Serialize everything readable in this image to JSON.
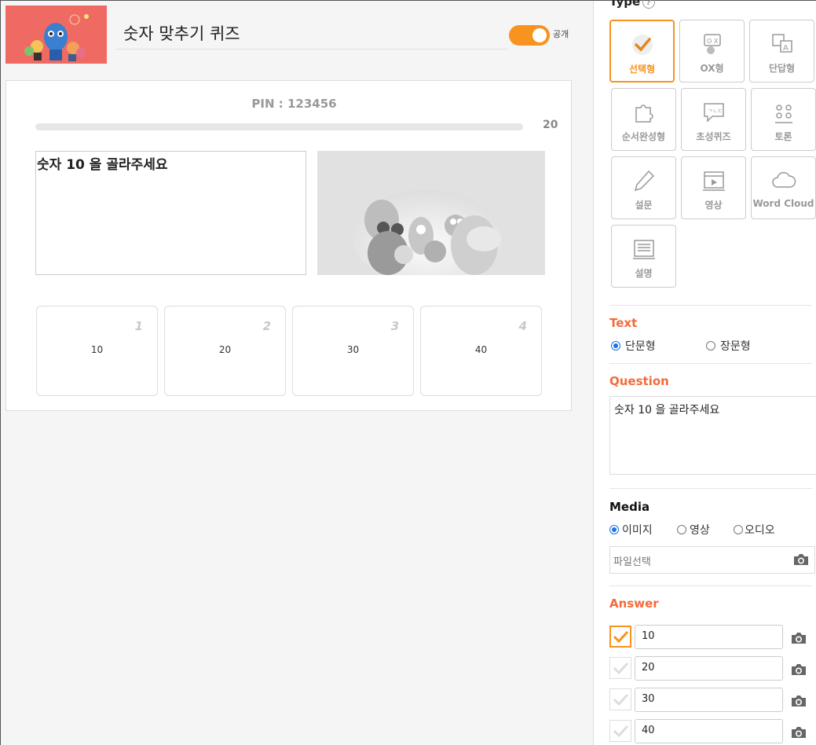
{
  "header": {
    "quiz_title": "숫자 맞추기 퀴즈",
    "toggle_label": "공개",
    "toggle_on": true
  },
  "preview": {
    "pin": "PIN : 123456",
    "timer": "20",
    "question": "숫자 10 을 골라주세요",
    "answers": [
      {
        "num": "1",
        "text": "10"
      },
      {
        "num": "2",
        "text": "20"
      },
      {
        "num": "3",
        "text": "30"
      },
      {
        "num": "4",
        "text": "40"
      }
    ]
  },
  "panel": {
    "type_title": "Type",
    "help_glyph": "?",
    "types": [
      {
        "label": "선택형",
        "icon": "check-icon",
        "active": true
      },
      {
        "label": "OX형",
        "icon": "ox-icon",
        "active": false
      },
      {
        "label": "단답형",
        "icon": "short-answer-icon",
        "active": false
      },
      {
        "label": "순서완성형",
        "icon": "puzzle-icon",
        "active": false
      },
      {
        "label": "초성퀴즈",
        "icon": "speech-bubble-icon",
        "active": false
      },
      {
        "label": "토론",
        "icon": "group-icon",
        "active": false
      },
      {
        "label": "설문",
        "icon": "pencil-icon",
        "active": false
      },
      {
        "label": "영상",
        "icon": "video-icon",
        "active": false
      },
      {
        "label": "Word Cloud",
        "icon": "cloud-icon",
        "active": false
      },
      {
        "label": "설명",
        "icon": "document-icon",
        "active": false
      }
    ],
    "text_section": {
      "title": "Text",
      "options": [
        {
          "label": "단문형",
          "selected": true
        },
        {
          "label": "장문형",
          "selected": false
        }
      ]
    },
    "question_section": {
      "title": "Question",
      "value": "숫자 10 을 골라주세요"
    },
    "media_section": {
      "title": "Media",
      "options": [
        {
          "label": "이미지",
          "selected": true
        },
        {
          "label": "영상",
          "selected": false
        },
        {
          "label": "오디오",
          "selected": false
        }
      ],
      "file_placeholder": "파일선택"
    },
    "answer_section": {
      "title": "Answer",
      "answers": [
        {
          "value": "10",
          "correct": true
        },
        {
          "value": "20",
          "correct": false
        },
        {
          "value": "30",
          "correct": false
        },
        {
          "value": "40",
          "correct": false
        }
      ]
    }
  },
  "colors": {
    "accent": "#f7931e",
    "section_title": "#f26b3a",
    "thumb_bg": "#f06a64"
  }
}
